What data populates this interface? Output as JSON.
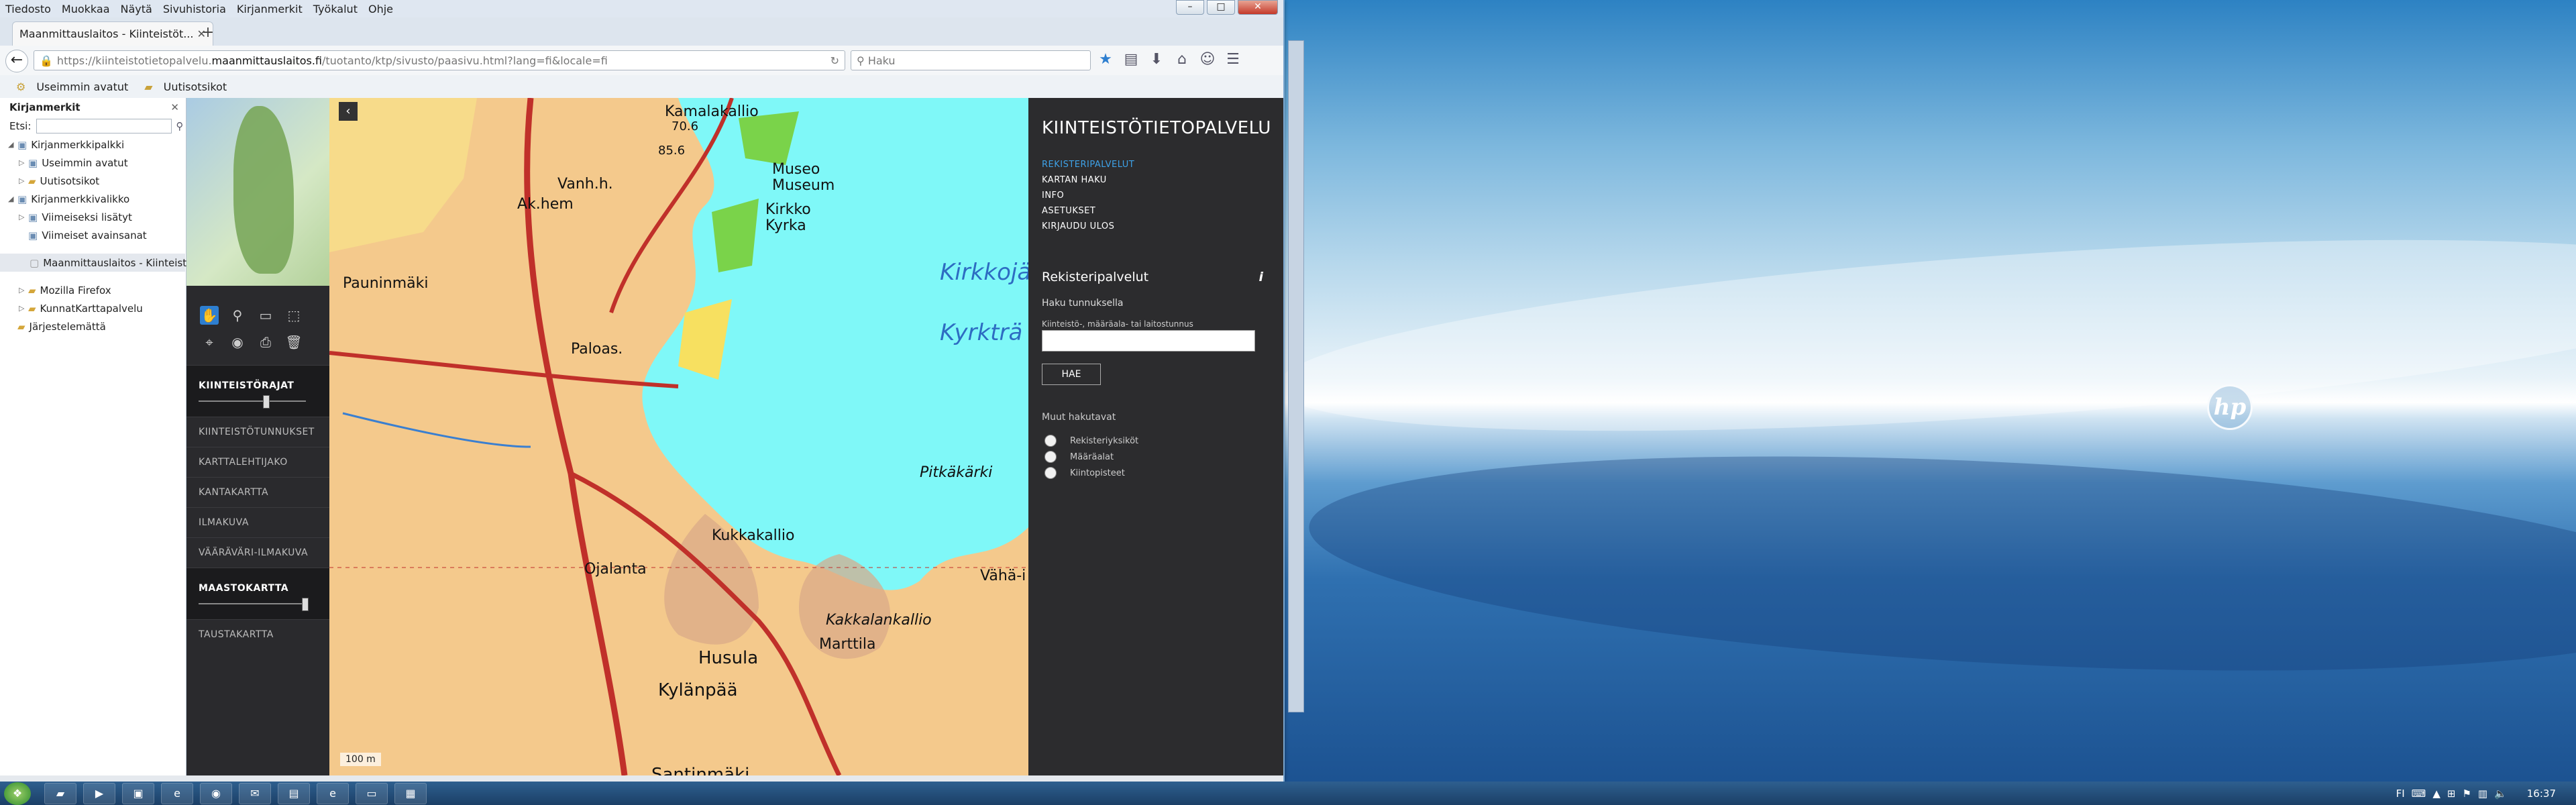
{
  "browser": {
    "menu": [
      "Tiedosto",
      "Muokkaa",
      "Näytä",
      "Sivuhistoria",
      "Kirjanmerkit",
      "Työkalut",
      "Ohje"
    ],
    "tab_title": "Maanmittauslaitos - Kiinteistöt...",
    "url_prefix": "https://kiinteistotietopalvelu.",
    "url_host": "maanmittauslaitos.fi",
    "url_path": "/tuotanto/ktp/sivusto/paasivu.html?lang=fi&locale=fi",
    "search_placeholder": "Haku",
    "bookmarks_bar": [
      "Useimmin avatut",
      "Uutisotsikot"
    ]
  },
  "sidebar": {
    "title": "Kirjanmerkit",
    "find_label": "Etsi:",
    "items": [
      {
        "label": "Kirjanmerkkipalkki",
        "depth": 0
      },
      {
        "label": "Useimmin avatut",
        "depth": 1
      },
      {
        "label": "Uutisotsikot",
        "depth": 1
      },
      {
        "label": "Kirjanmerkkivalikko",
        "depth": 0
      },
      {
        "label": "Viimeiseksi lisätyt",
        "depth": 1
      },
      {
        "label": "Viimeiset avainsanat",
        "depth": 1
      },
      {
        "label": "Maanmittauslaitos - Kiinteistö...",
        "depth": 1
      },
      {
        "label": "Mozilla Firefox",
        "depth": 1
      },
      {
        "label": "KunnatKarttapalvelu",
        "depth": 1
      },
      {
        "label": "Järjestelemättä",
        "depth": 0
      }
    ]
  },
  "layers": {
    "items": [
      {
        "label": "KIINTEISTÖRAJAT",
        "opacity": 0.6
      },
      {
        "label": "KIINTEISTÖTUNNUKSET"
      },
      {
        "label": "KARTTALEHTIJAKO"
      },
      {
        "label": "KANTAKARTTA"
      },
      {
        "label": "ILMAKUVA"
      },
      {
        "label": "VÄÄRÄVÄRI-ILMAKUVA"
      },
      {
        "label": "MAASTOKARTTA",
        "opacity": 1.0
      },
      {
        "label": "TAUSTAKARTTA"
      }
    ]
  },
  "map": {
    "labels": [
      "Kamalakallio",
      "70.6",
      "85.6",
      "Vanh.h.",
      "Museo",
      "Museum",
      "Ak.hem",
      "Kirkko",
      "Kyrka",
      "Kirkkojä",
      "Kyrkträ",
      "Pauninmäki",
      "Paloas.",
      "Pitkäkärki",
      "Kukkakallio",
      "Ojalanta",
      "Vähä-i",
      "Kakkalankallio",
      "Marttila",
      "Husula",
      "Kylänpää",
      "Santinmäki"
    ],
    "scale": "100 m"
  },
  "panel": {
    "title": "KIINTEISTÖTIETOPALVELU",
    "menu": [
      "REKISTERIPALVELUT",
      "KARTAN HAKU",
      "INFO",
      "ASETUKSET",
      "KIRJAUDU ULOS"
    ],
    "section": "Rekisteripalvelut",
    "search_heading": "Haku tunnuksella",
    "input_label": "Kiinteistö-, määräala- tai laitostunnus",
    "button": "HAE",
    "other_heading": "Muut hakutavat",
    "radios": [
      "Rekisteriyksiköt",
      "Määräalat",
      "Kiintopisteet"
    ]
  },
  "taskbar": {
    "clock": "16:37",
    "lang": "FI"
  },
  "colors": {
    "water": "#7ff8f8",
    "land": "#f4c98c",
    "road": "#c0302a",
    "panel_bg": "#2c2c2e",
    "accent": "#3ea2e8"
  }
}
